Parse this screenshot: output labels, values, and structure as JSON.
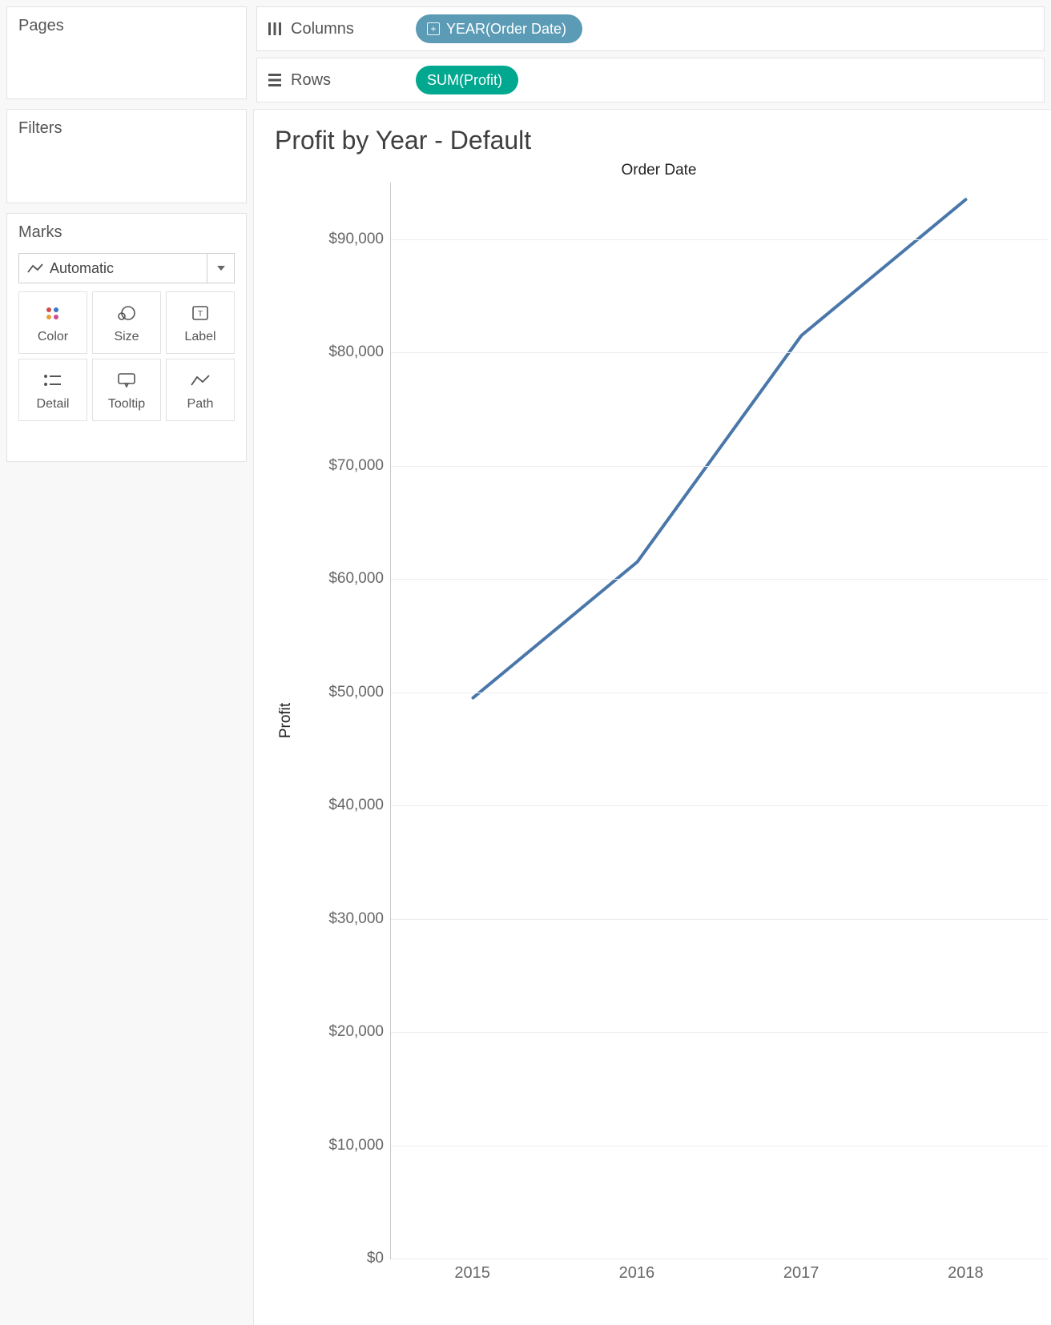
{
  "panels": {
    "pages_title": "Pages",
    "filters_title": "Filters",
    "marks_title": "Marks"
  },
  "marks": {
    "type_selected": "Automatic",
    "buttons": {
      "color": "Color",
      "size": "Size",
      "label": "Label",
      "detail": "Detail",
      "tooltip": "Tooltip",
      "path": "Path"
    }
  },
  "shelves": {
    "columns_label": "Columns",
    "rows_label": "Rows",
    "columns_pill": "YEAR(Order Date)",
    "rows_pill": "SUM(Profit)"
  },
  "chart": {
    "title": "Profit by Year - Default",
    "header_label": "Order Date",
    "yaxis_label": "Profit"
  },
  "chart_ticks": {
    "y_values": [
      0,
      10000,
      20000,
      30000,
      40000,
      50000,
      60000,
      70000,
      80000,
      90000
    ],
    "y_labels": [
      "$0",
      "$10,000",
      "$20,000",
      "$30,000",
      "$40,000",
      "$50,000",
      "$60,000",
      "$70,000",
      "$80,000",
      "$90,000"
    ],
    "x_labels": [
      "2015",
      "2016",
      "2017",
      "2018"
    ]
  },
  "chart_data": {
    "type": "line",
    "title": "Profit by Year - Default",
    "xlabel": "Order Date",
    "ylabel": "Profit",
    "ylim": [
      0,
      95000
    ],
    "x": [
      "2015",
      "2016",
      "2017",
      "2018"
    ],
    "values": [
      49500,
      61500,
      81500,
      93500
    ],
    "series_color": "#4a77aa"
  }
}
